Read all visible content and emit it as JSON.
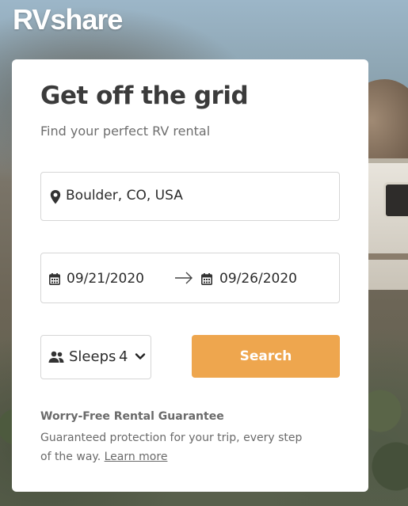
{
  "brand": {
    "logo_text": "RVshare",
    "accent": "#eea64e"
  },
  "hero": {
    "title": "Get off the grid",
    "subtitle": "Find your perfect RV rental"
  },
  "search": {
    "location": {
      "value": "Boulder, CO, USA",
      "icon": "map-pin-icon"
    },
    "dates": {
      "start": "09/21/2020",
      "end": "09/26/2020",
      "icon": "calendar-icon",
      "separator_icon": "arrow-right-icon"
    },
    "sleeps": {
      "label": "Sleeps",
      "value": "4",
      "icon": "people-icon",
      "dropdown_icon": "chevron-down-icon"
    },
    "button_label": "Search"
  },
  "guarantee": {
    "title": "Worry-Free Rental Guarantee",
    "body": "Guaranteed protection for your trip, every step of the way.",
    "link_text": "Learn more"
  }
}
